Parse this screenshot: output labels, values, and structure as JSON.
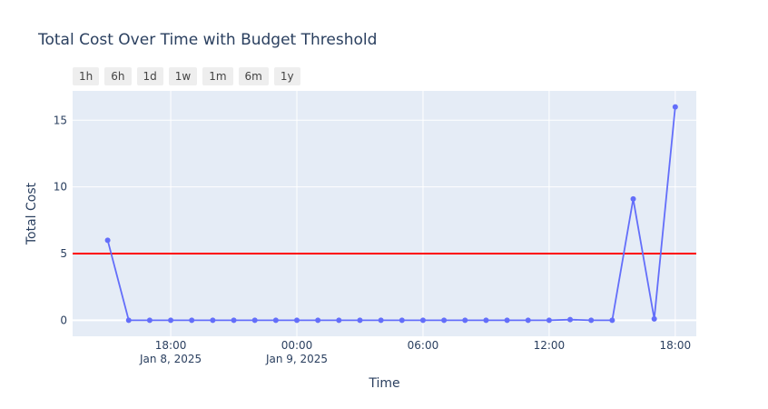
{
  "title": "Total Cost Over Time with Budget Threshold",
  "range_buttons": [
    "1h",
    "6h",
    "1d",
    "1w",
    "1m",
    "6m",
    "1y"
  ],
  "colors": {
    "line": "#636efa",
    "threshold": "#ff0000",
    "plot_bg": "#e5ecf6",
    "grid": "#ffffff"
  },
  "chart_data": {
    "type": "line",
    "title": "Total Cost Over Time with Budget Threshold",
    "xlabel": "Time",
    "ylabel": "Total Cost",
    "x_range": [
      "2025-01-08 13:20",
      "2025-01-09 19:00"
    ],
    "ylim": [
      -1.2,
      17.2
    ],
    "grid": true,
    "x_ticks": [
      {
        "x": "2025-01-08 18:00",
        "label": "18:00",
        "sublabel": "Jan 8, 2025"
      },
      {
        "x": "2025-01-09 00:00",
        "label": "00:00",
        "sublabel": "Jan 9, 2025"
      },
      {
        "x": "2025-01-09 06:00",
        "label": "06:00",
        "sublabel": ""
      },
      {
        "x": "2025-01-09 12:00",
        "label": "12:00",
        "sublabel": ""
      },
      {
        "x": "2025-01-09 18:00",
        "label": "18:00",
        "sublabel": ""
      }
    ],
    "y_ticks": [
      0,
      5,
      10,
      15
    ],
    "threshold": 5,
    "series": [
      {
        "x": [
          "2025-01-08 15:00",
          "2025-01-08 16:00",
          "2025-01-08 17:00",
          "2025-01-08 18:00",
          "2025-01-08 19:00",
          "2025-01-08 20:00",
          "2025-01-08 21:00",
          "2025-01-08 22:00",
          "2025-01-08 23:00",
          "2025-01-09 00:00",
          "2025-01-09 01:00",
          "2025-01-09 02:00",
          "2025-01-09 03:00",
          "2025-01-09 04:00",
          "2025-01-09 05:00",
          "2025-01-09 06:00",
          "2025-01-09 07:00",
          "2025-01-09 08:00",
          "2025-01-09 09:00",
          "2025-01-09 10:00",
          "2025-01-09 11:00",
          "2025-01-09 12:00",
          "2025-01-09 13:00",
          "2025-01-09 14:00",
          "2025-01-09 15:00",
          "2025-01-09 16:00",
          "2025-01-09 17:00",
          "2025-01-09 18:00"
        ],
        "values": [
          6,
          0,
          0,
          0,
          0,
          0,
          0,
          0,
          0,
          0,
          0,
          0,
          0,
          0,
          0,
          0,
          0,
          0,
          0,
          0,
          0,
          0,
          0.05,
          0,
          0,
          9.1,
          0.1,
          16
        ]
      }
    ]
  }
}
